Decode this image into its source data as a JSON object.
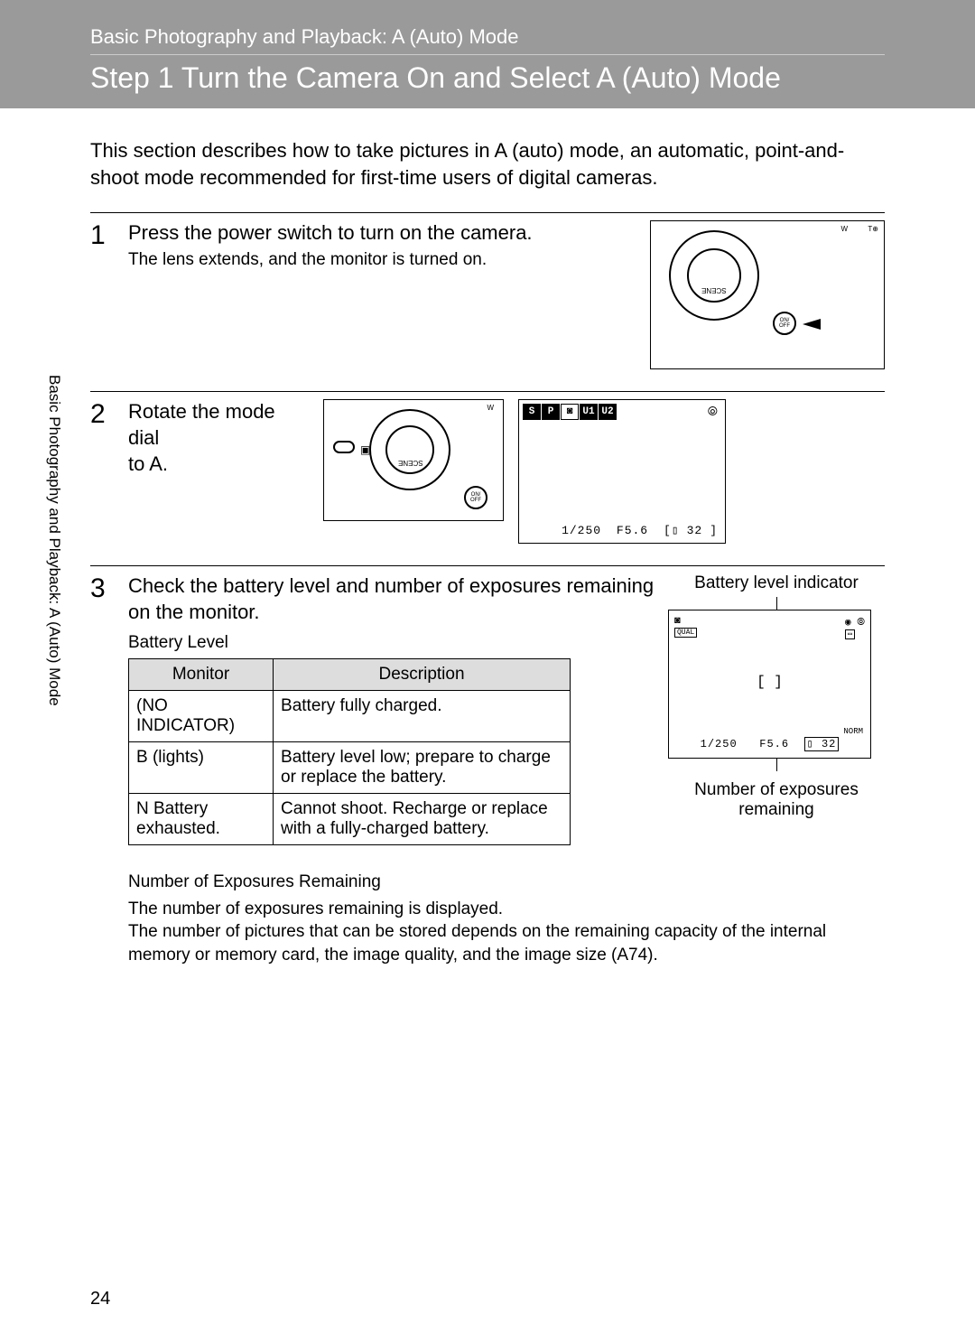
{
  "breadcrumb": "Basic Photography and Playback: A (Auto) Mode",
  "page_title": "Step 1 Turn the Camera On and Select A (Auto) Mode",
  "intro": "This section describes how to take pictures in A (auto) mode, an automatic, point-and-shoot mode recommended for first-time users of digital cameras.",
  "side_tab": "Basic Photography and Playback: A (Auto) Mode",
  "steps": {
    "s1": {
      "num": "1",
      "title": "Press the power switch to turn on the camera.",
      "sub": "The lens extends, and the monitor is turned on."
    },
    "s2": {
      "num": "2",
      "title_l1": "Rotate the mode dial",
      "title_l2": "to A.",
      "lcd": {
        "strip": {
          "s": "S",
          "p": "P",
          "u1": "U1",
          "u2": "U2"
        },
        "shutter": "1/250",
        "aperture": "F5.6",
        "frames": "32"
      }
    },
    "s3": {
      "num": "3",
      "title": "Check the battery level and number of exposures remaining on the monitor.",
      "battery_heading": "Battery Level",
      "table": {
        "h1": "Monitor",
        "h2": "Description",
        "r1c1": "(NO INDICATOR)",
        "r1c2": "Battery fully charged.",
        "r2c1": "B (lights)",
        "r2c2": "Battery level low; prepare to charge or replace the battery.",
        "r3c1": "N Battery exhausted.",
        "r3c2": "Cannot shoot. Recharge or replace with a fully-charged battery."
      },
      "bli_label": "Battery level indicator",
      "lcd2": {
        "qual": "QUAL",
        "brackets": "[   ]",
        "norm": "NORM",
        "shutter": "1/250",
        "aperture": "F5.6",
        "frames": "32"
      },
      "noe_label_l1": "Number of exposures",
      "noe_label_l2": "remaining"
    }
  },
  "noe_section": {
    "title": "Number of Exposures Remaining",
    "line1": "The number of exposures remaining is displayed.",
    "line2": "The number of pictures that can be stored depends on the remaining capacity of the internal memory or memory card, the image quality, and the image size (A74)."
  },
  "page_number": "24"
}
